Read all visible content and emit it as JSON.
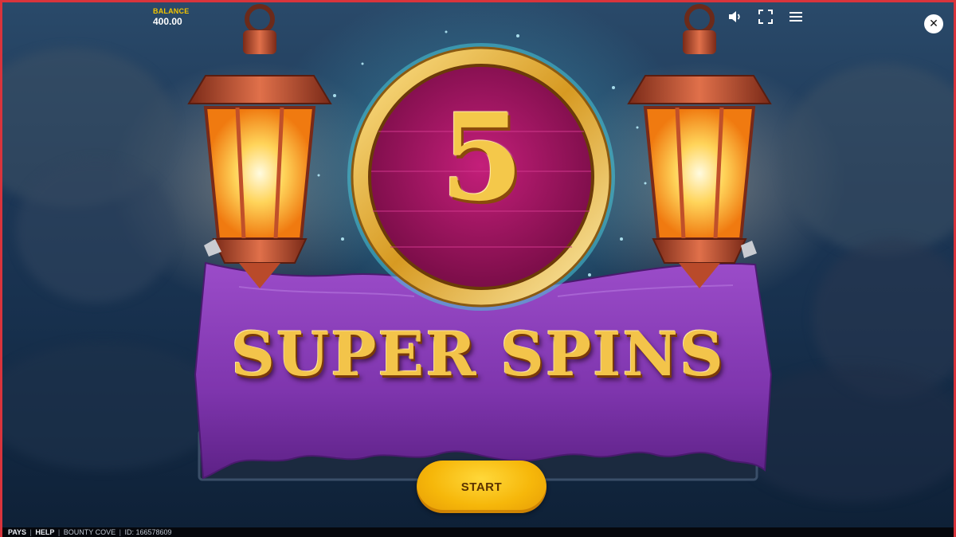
{
  "balance": {
    "label": "BALANCE",
    "value": "400.00"
  },
  "controls": {
    "sound_icon": "speaker-icon",
    "fullscreen_icon": "fullscreen-icon",
    "menu_icon": "hamburger-menu-icon",
    "close_icon": "close-icon",
    "close_glyph": "✕"
  },
  "feature": {
    "spins_count": "5",
    "title": "SUPER SPINS"
  },
  "start_button": {
    "label": "START"
  },
  "footer": {
    "pays": "PAYS",
    "help": "HELP",
    "separator": "|",
    "game_name": "BOUNTY COVE",
    "id_text": "ID: 166578609"
  },
  "colors": {
    "accent_gold": "#f4c84a",
    "balance_label": "#f2c400",
    "banner_purple": "#8a3fb5",
    "badge_magenta": "#a01565",
    "start_yellow": "#f6b70a",
    "frame_red": "#d9343c"
  }
}
